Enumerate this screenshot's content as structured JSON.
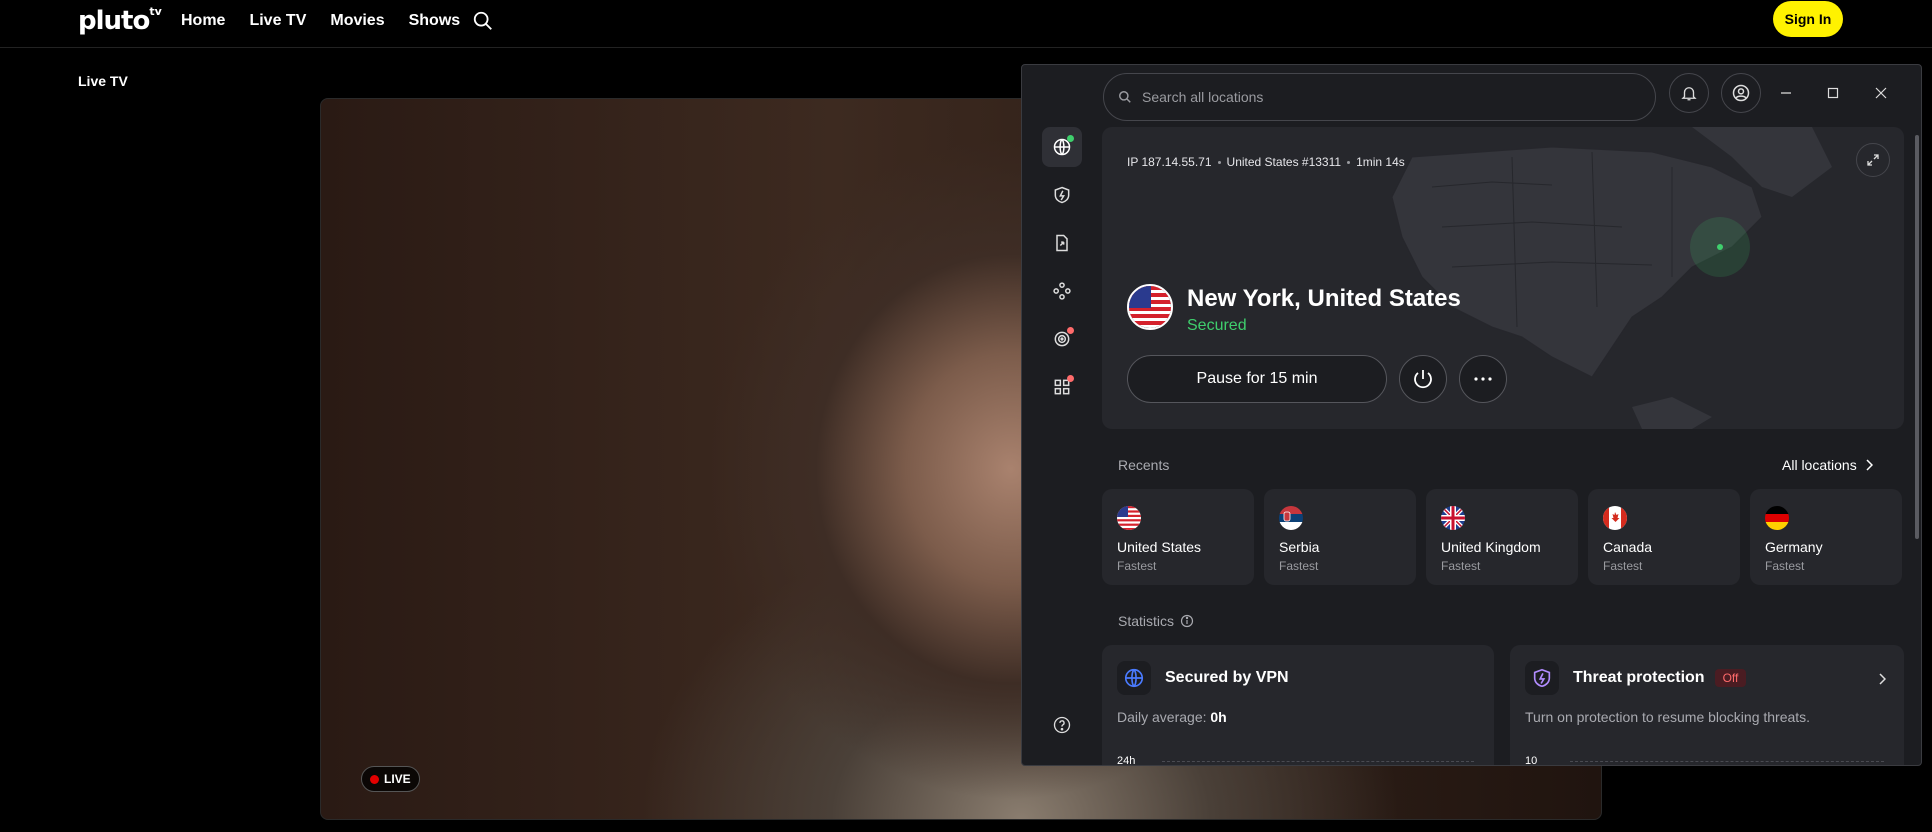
{
  "pluto": {
    "logo": "pluto",
    "logo_sup": "tv",
    "nav": [
      "Home",
      "Live TV",
      "Movies",
      "Shows"
    ],
    "signin": "Sign In",
    "section_title": "Live TV",
    "live_label": "LIVE"
  },
  "vpn": {
    "search_placeholder": "Search all locations",
    "ip": "IP 187.14.55.71",
    "server": "United States #13311",
    "duration": "1min 14s",
    "city": "New York, United States",
    "status": "Secured",
    "pause_label": "Pause for 15 min",
    "recents_label": "Recents",
    "all_locations": "All locations",
    "recents": [
      {
        "name": "United States",
        "sub": "Fastest",
        "flag": "us-flag"
      },
      {
        "name": "Serbia",
        "sub": "Fastest",
        "flag": "rs-flag"
      },
      {
        "name": "United Kingdom",
        "sub": "Fastest",
        "flag": "gb-flag"
      },
      {
        "name": "Canada",
        "sub": "Fastest",
        "flag": "ca-flag"
      },
      {
        "name": "Germany",
        "sub": "Fastest",
        "flag": "de-flag"
      }
    ],
    "statistics_label": "Statistics",
    "stat_vpn": {
      "title": "Secured by VPN",
      "desc_prefix": "Daily average: ",
      "desc_value": "0h",
      "axis": "24h"
    },
    "stat_threat": {
      "title": "Threat protection",
      "badge": "Off",
      "desc": "Turn on protection to resume blocking threats.",
      "axis": "10"
    }
  },
  "colors": {
    "accent_green": "#3fcf6d",
    "pluto_yellow": "#fff200",
    "alert_red": "#ff6b6b"
  }
}
